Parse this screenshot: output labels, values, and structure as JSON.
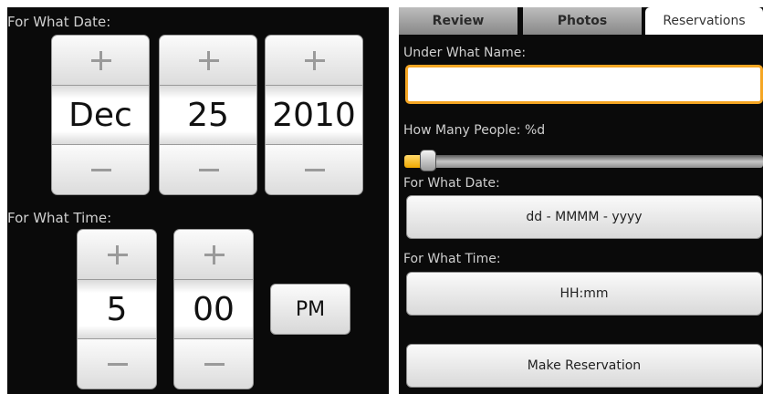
{
  "left": {
    "date_label": "For What Date:",
    "date": {
      "month": "Dec",
      "day": "25",
      "year": "2010"
    },
    "time_label": "For What Time:",
    "time": {
      "hour": "5",
      "minute": "00",
      "ampm": "PM"
    }
  },
  "right": {
    "tabs": [
      "Review",
      "Photos",
      "Reservations"
    ],
    "selected_tab": "Reservations",
    "name_label": "Under What Name:",
    "name_value": "",
    "people_label": "How Many People: %d",
    "people_progress_fraction": 0.02,
    "date_label": "For What Date:",
    "date_button": "dd - MMMM - yyyy",
    "time_label": "For What Time:",
    "time_button": "HH:mm",
    "submit_button": "Make Reservation"
  },
  "colors": {
    "accent": "#f5a623",
    "background": "#0a0a0a"
  }
}
